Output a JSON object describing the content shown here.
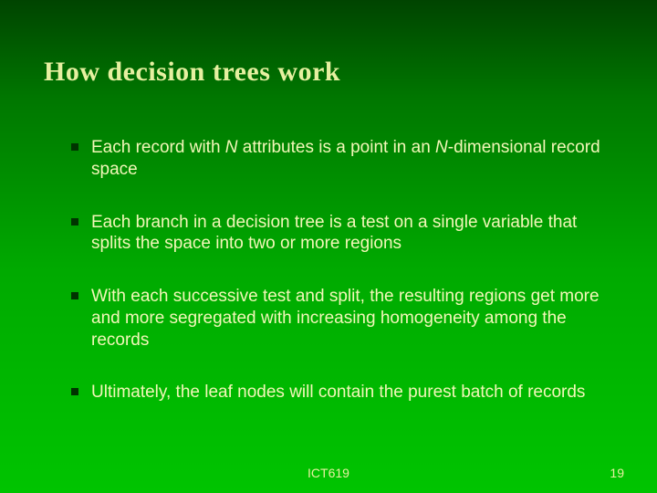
{
  "title": "How decision trees work",
  "bullets": [
    {
      "pre": "Each record with ",
      "em1": "N",
      "mid": " attributes is a point in an ",
      "em2": "N",
      "post": "-dimensional record space"
    },
    {
      "pre": "Each branch in a decision tree is a test on a single variable that splits the space into two or more regions",
      "em1": "",
      "mid": "",
      "em2": "",
      "post": ""
    },
    {
      "pre": "With each successive test and split, the resulting regions get more and more segregated with increasing homogeneity among the records",
      "em1": "",
      "mid": "",
      "em2": "",
      "post": ""
    },
    {
      "pre": "Ultimately, the leaf nodes will contain the purest batch of records",
      "em1": "",
      "mid": "",
      "em2": "",
      "post": ""
    }
  ],
  "footer": "ICT619",
  "page": "19"
}
